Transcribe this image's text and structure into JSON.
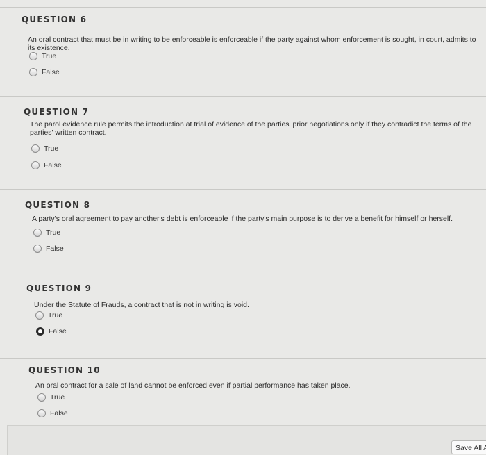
{
  "questions": [
    {
      "title": "QUESTION 6",
      "text": "An oral contract that must be in writing to be enforceable is enforceable if the party against whom enforcement is sought, in court, admits to its existence.",
      "options": [
        {
          "label": "True",
          "selected": false
        },
        {
          "label": "False",
          "selected": false
        }
      ]
    },
    {
      "title": "QUESTION 7",
      "text": "The parol evidence rule permits the introduction at trial of evidence of the parties' prior negotiations only if they contradict the terms of the parties' written contract.",
      "options": [
        {
          "label": "True",
          "selected": false
        },
        {
          "label": "False",
          "selected": false
        }
      ]
    },
    {
      "title": "QUESTION 8",
      "text": "A party's oral agreement to pay another's debt is enforceable if the party's main purpose is to derive a benefit for himself or herself.",
      "options": [
        {
          "label": "True",
          "selected": false
        },
        {
          "label": "False",
          "selected": false
        }
      ]
    },
    {
      "title": "QUESTION 9",
      "text": "Under the Statute of Frauds, a contract that is not in writing is void.",
      "options": [
        {
          "label": "True",
          "selected": false
        },
        {
          "label": "False",
          "selected": true
        }
      ]
    },
    {
      "title": "QUESTION 10",
      "text": "An oral contract for a sale of land cannot be enforced even if partial performance has taken place.",
      "options": [
        {
          "label": "True",
          "selected": false
        },
        {
          "label": "False",
          "selected": false
        }
      ]
    }
  ],
  "footer": {
    "save_all_label": "Save All A"
  }
}
